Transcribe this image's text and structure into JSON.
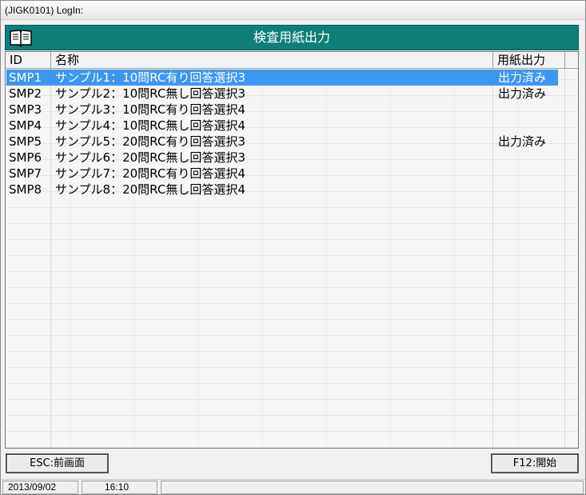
{
  "window": {
    "title": "(JIGK0101)  LogIn:"
  },
  "banner": {
    "title": "検査用紙出力",
    "icon": "book-icon"
  },
  "table": {
    "columns": [
      "ID",
      "名称",
      "用紙出力"
    ],
    "selected_index": 0,
    "rows": [
      {
        "id": "SMP1",
        "name": "サンプル1：10問RC有り回答選択3",
        "status": "出力済み"
      },
      {
        "id": "SMP2",
        "name": "サンプル2：10問RC無し回答選択3",
        "status": "出力済み"
      },
      {
        "id": "SMP3",
        "name": "サンプル3：10問RC有り回答選択4",
        "status": ""
      },
      {
        "id": "SMP4",
        "name": "サンプル4：10問RC無し回答選択4",
        "status": ""
      },
      {
        "id": "SMP5",
        "name": "サンプル5：20問RC有り回答選択3",
        "status": "出力済み"
      },
      {
        "id": "SMP6",
        "name": "サンプル6：20問RC無し回答選択3",
        "status": ""
      },
      {
        "id": "SMP7",
        "name": "サンプル7：20問RC有り回答選択4",
        "status": ""
      },
      {
        "id": "SMP8",
        "name": "サンプル8：20問RC無し回答選択4",
        "status": ""
      }
    ]
  },
  "buttons": {
    "esc_label": "ESC:前画面",
    "f12_label": "F12:開始"
  },
  "statusbar": {
    "date": "2013/09/02",
    "time": "16:10",
    "message": ""
  },
  "colors": {
    "banner_bg": "#0e7f78",
    "selection_bg": "#3d96f0"
  }
}
